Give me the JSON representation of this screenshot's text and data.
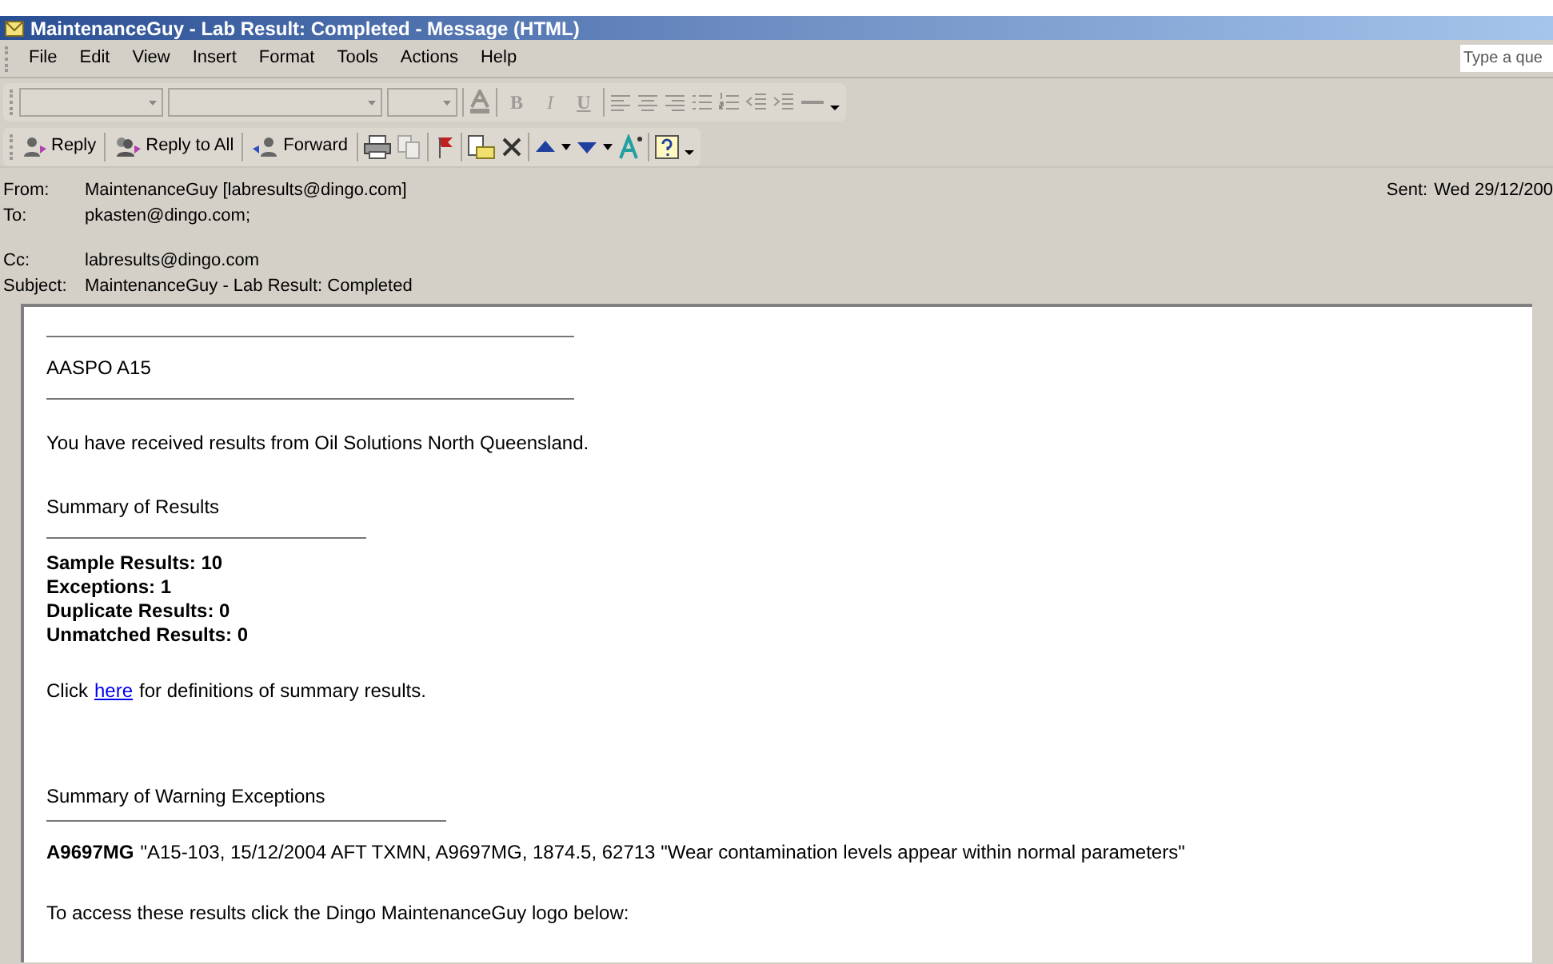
{
  "window": {
    "title": "MaintenanceGuy - Lab Result: Completed - Message (HTML)"
  },
  "menu": [
    {
      "label": "File"
    },
    {
      "label": "Edit"
    },
    {
      "label": "View"
    },
    {
      "label": "Insert"
    },
    {
      "label": "Format"
    },
    {
      "label": "Tools"
    },
    {
      "label": "Actions"
    },
    {
      "label": "Help"
    }
  ],
  "help_box": {
    "placeholder": "Type a que"
  },
  "format_toolbar": {
    "disabled": true,
    "buttons": [
      {
        "kind": "bold",
        "label": "B"
      },
      {
        "kind": "italic",
        "label": "I"
      },
      {
        "kind": "underline",
        "label": "U"
      }
    ]
  },
  "standard_toolbar": [
    {
      "label": "Reply"
    },
    {
      "label": "Reply to All"
    },
    {
      "label": "Forward"
    }
  ],
  "header": [
    {
      "label": "From:",
      "value": "MaintenanceGuy [labresults@dingo.com]",
      "sent_label": "Sent:",
      "sent": "Wed 29/12/200"
    },
    {
      "label": "To:",
      "value": "pkasten@dingo.com;"
    },
    {
      "label": "Cc:",
      "value": "labresults@dingo.com"
    },
    {
      "label": "Subject:",
      "value": "MaintenanceGuy - Lab Result: Completed"
    }
  ],
  "body": {
    "heading": "AASPO A15",
    "intro": "You have received results from Oil Solutions North Queensland.",
    "summary_title": "Summary of Results",
    "summary": [
      "Sample Results: 10",
      "Exceptions: 1",
      "Duplicate Results: 0",
      "Unmatched Results: 0"
    ],
    "click_before": "Click",
    "link": "here",
    "click_after": "for definitions of summary results.",
    "warning_title": "Summary of Warning Exceptions",
    "warning_id": "A9697MG",
    "warning_text": "\"A15-103, 15/12/2004 AFT TXMN, A9697MG, 1874.5, 62713 \"Wear contamination levels appear within normal parameters\"",
    "access": "To access these results click the Dingo MaintenanceGuy logo below:"
  }
}
